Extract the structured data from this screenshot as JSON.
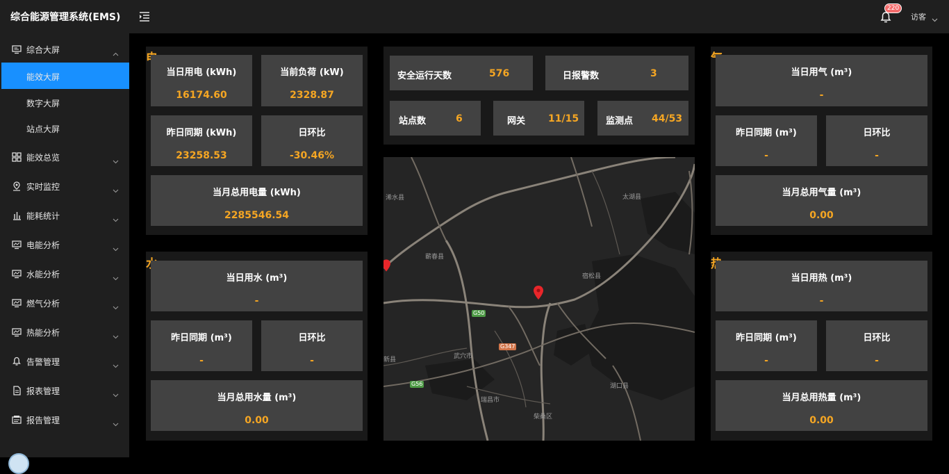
{
  "header": {
    "title": "综合能源管理系统(EMS)",
    "notification_count": "220",
    "user": "访客"
  },
  "sidebar": {
    "items": [
      {
        "label": "综合大屏",
        "icon": "monitor-icon",
        "expanded": true
      },
      {
        "label": "能效总览",
        "icon": "grid-icon"
      },
      {
        "label": "实时监控",
        "icon": "location-pin-icon"
      },
      {
        "label": "能耗统计",
        "icon": "bar-chart-icon"
      },
      {
        "label": "电能分析",
        "icon": "chart-monitor-icon"
      },
      {
        "label": "水能分析",
        "icon": "chart-monitor-icon"
      },
      {
        "label": "燃气分析",
        "icon": "chart-monitor-icon"
      },
      {
        "label": "热能分析",
        "icon": "chart-monitor-icon"
      },
      {
        "label": "告警管理",
        "icon": "bell-icon"
      },
      {
        "label": "报表管理",
        "icon": "document-icon"
      },
      {
        "label": "报告管理",
        "icon": "report-icon"
      }
    ],
    "sub_items": [
      {
        "label": "能效大屏",
        "active": true
      },
      {
        "label": "数字大屏"
      },
      {
        "label": "站点大屏"
      }
    ]
  },
  "electric": {
    "section": "电",
    "today_label": "当日用电 (kWh)",
    "today_value": "16174.60",
    "load_label": "当前负荷 (kW)",
    "load_value": "2328.87",
    "yesterday_label": "昨日同期 (kWh)",
    "yesterday_value": "23258.53",
    "ratio_label": "日环比",
    "ratio_value": "-30.46%",
    "month_label": "当月总用电量 (kWh)",
    "month_value": "2285546.54"
  },
  "water": {
    "section": "水",
    "today_label": "当日用水 (m³)",
    "today_value": "-",
    "yesterday_label": "昨日同期 (m³)",
    "yesterday_value": "-",
    "ratio_label": "日环比",
    "ratio_value": "-",
    "month_label": "当月总用水量 (m³)",
    "month_value": "0.00"
  },
  "gas": {
    "section": "气",
    "today_label": "当日用气 (m³)",
    "today_value": "-",
    "yesterday_label": "昨日同期 (m³)",
    "yesterday_value": "-",
    "ratio_label": "日环比",
    "ratio_value": "-",
    "month_label": "当月总用气量 (m³)",
    "month_value": "0.00"
  },
  "heat": {
    "section": "热",
    "today_label": "当日用热 (m³)",
    "today_value": "-",
    "yesterday_label": "昨日同期 (m³)",
    "yesterday_value": "-",
    "ratio_label": "日环比",
    "ratio_value": "-",
    "month_label": "当月总用热量 (m³)",
    "month_value": "0.00"
  },
  "stats": {
    "safe_days_label": "安全运行天数",
    "safe_days_value": "576",
    "alarms_label": "日报警数",
    "alarms_value": "3",
    "sites_label": "站点数",
    "sites_value": "6",
    "gateway_label": "网关",
    "gateway_value": "11/15",
    "points_label": "监测点",
    "points_value": "44/53"
  },
  "map": {
    "places": [
      "浠水县",
      "太湖县",
      "蕲春县",
      "宿松县",
      "武穴市",
      "瑞昌市",
      "湖口县",
      "柴桑区",
      "新县"
    ],
    "roads": [
      "G50",
      "G347",
      "G56"
    ]
  },
  "colors": {
    "accent": "#f5a623",
    "active": "#1890ff",
    "badge": "#f56c6c",
    "tile": "#424242"
  }
}
